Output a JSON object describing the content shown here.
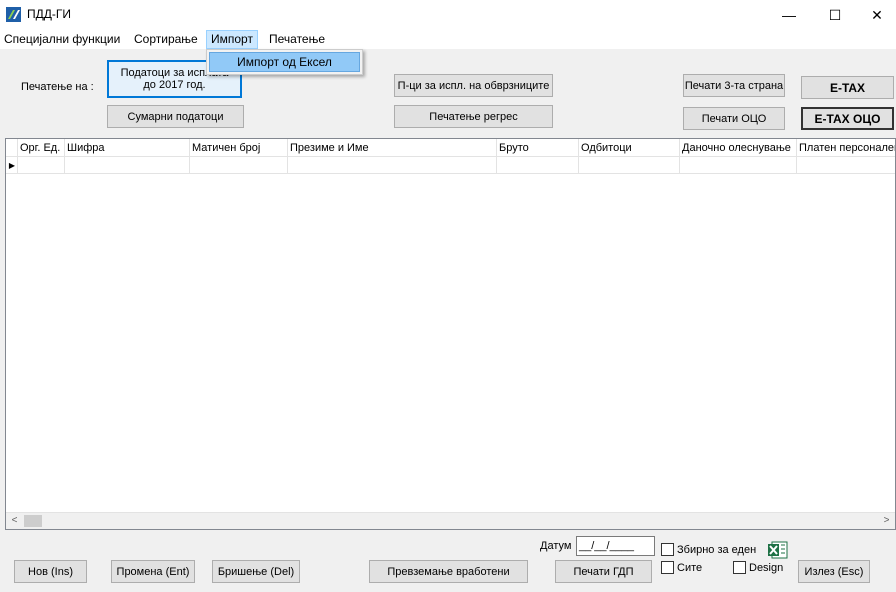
{
  "window": {
    "title": "ПДД-ГИ",
    "minimize": "—",
    "maximize": "☐",
    "close": "✕"
  },
  "menu": {
    "items": [
      "Специјални функции",
      "Сортирање",
      "Импорт",
      "Печатење"
    ],
    "open_menu": "Импорт",
    "dropdown": [
      "Импорт од Ексел"
    ]
  },
  "toolbar": {
    "print_on_label": "Печатење на :",
    "data_payout_button": "Податоци за исплата до 2017 год.",
    "summary_button": "Сумарни податоци",
    "pci_button": "П-ци за испл. на обврзниците",
    "regress_button": "Печатење регрес",
    "print_3rd_party_button": "Печати 3-та страна",
    "print_oco_button": "Печати ОЦО",
    "etax_button": "E-TAX",
    "etax_oco_button": "E-TAX ОЦО"
  },
  "grid": {
    "columns": [
      "Орг. Ед.",
      "Шифра",
      "Матичен број",
      "Презиме и Име",
      "Бруто",
      "Одбитоци",
      "Даночно олеснување",
      "Платен персонален"
    ],
    "current_row_marker": "▶"
  },
  "scrollbar": {
    "left_arrow": "<",
    "right_arrow": ">"
  },
  "footer": {
    "new_button": "Нов (Ins)",
    "edit_button": "Промена (Ent)",
    "delete_button": "Бришење (Del)",
    "import_employees_button": "Превземање вработени",
    "print_gdp_button": "Печати ГДП",
    "exit_button": "Излез (Esc)",
    "date_label": "Датум",
    "date_value": "__/__/____",
    "summary_for_one_label": "Збирно за еден",
    "all_label": "Сите",
    "design_label": "Design"
  },
  "colors": {
    "accent": "#0078d7",
    "menu_highlight": "#91c9f7",
    "excel_green": "#1e7145"
  }
}
